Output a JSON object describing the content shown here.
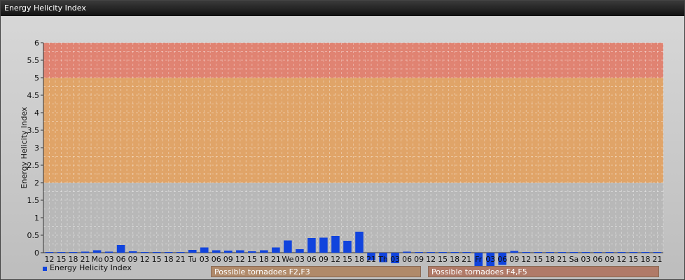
{
  "window": {
    "title": "Energy Helicity Index"
  },
  "legend": {
    "label": "Energy Helicity Index",
    "color": "#1144dd"
  },
  "zones": [
    {
      "label": "Possible tornadoes F2,F3",
      "color": "#b08a6a"
    },
    {
      "label": "Possible tornadoes F4,F5",
      "color": "#b07a68"
    }
  ],
  "chart_data": {
    "type": "bar",
    "ylabel": "Energy Helicity Index",
    "ylim": [
      -0.6,
      6
    ],
    "yticks": [
      0,
      0.5,
      1,
      1.5,
      2,
      2.5,
      3,
      3.5,
      4,
      4.5,
      5,
      5.5,
      6
    ],
    "grid": true,
    "bands": [
      {
        "from": 0,
        "to": 2,
        "color": "#b8b8b8"
      },
      {
        "from": 2,
        "to": 5,
        "color": "#e0a468"
      },
      {
        "from": 5,
        "to": 6,
        "color": "#e08372"
      }
    ],
    "categories": [
      "12",
      "15",
      "18",
      "21",
      "Mo",
      "03",
      "06",
      "09",
      "12",
      "15",
      "18",
      "21",
      "Tu",
      "03",
      "06",
      "09",
      "12",
      "15",
      "18",
      "21",
      "We",
      "03",
      "06",
      "09",
      "12",
      "15",
      "18",
      "21",
      "Th",
      "03",
      "06",
      "09",
      "12",
      "15",
      "18",
      "21",
      "Fr",
      "03",
      "06",
      "09",
      "12",
      "15",
      "18",
      "21",
      "Sa",
      "03",
      "06",
      "09",
      "12",
      "15",
      "18",
      "21"
    ],
    "series": [
      {
        "name": "Energy Helicity Index",
        "values": [
          0.02,
          0.02,
          0.02,
          0.03,
          0.07,
          0.03,
          0.22,
          0.04,
          0.02,
          0.02,
          0.02,
          0.02,
          0.08,
          0.15,
          0.07,
          0.06,
          0.07,
          0.04,
          0.07,
          0.15,
          0.35,
          0.1,
          0.42,
          0.43,
          0.48,
          0.34,
          0.6,
          -0.22,
          -0.27,
          -0.3,
          0.03,
          0.02,
          0.02,
          0.02,
          0.02,
          0.02,
          -0.6,
          -0.65,
          -0.35,
          0.05,
          0.02,
          0.02,
          0.02,
          0.02,
          0.02,
          0.02,
          0.02,
          0.02,
          0.02,
          0.02,
          0.02,
          0.02
        ]
      }
    ]
  }
}
